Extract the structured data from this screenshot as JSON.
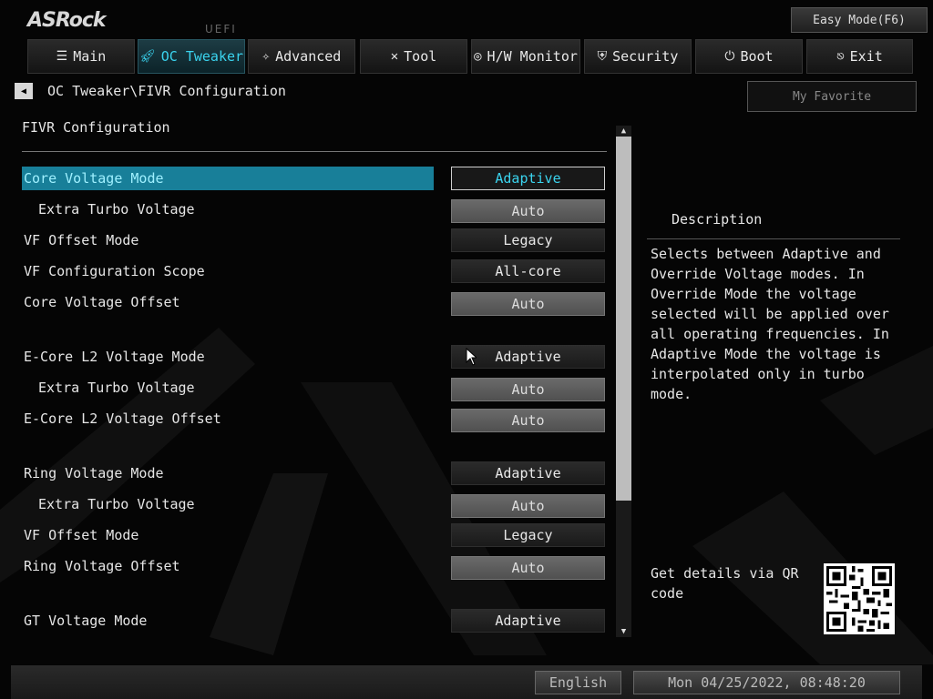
{
  "brand": {
    "logo": "ASRock",
    "firmware": "UEFI"
  },
  "header": {
    "easy_mode": "Easy Mode(F6)"
  },
  "tabs": [
    {
      "label": "Main",
      "icon": "list-icon"
    },
    {
      "label": "OC Tweaker",
      "icon": "rocket-icon",
      "active": true
    },
    {
      "label": "Advanced",
      "icon": "star-icon"
    },
    {
      "label": "Tool",
      "icon": "tools-icon"
    },
    {
      "label": "H/W Monitor",
      "icon": "monitor-icon"
    },
    {
      "label": "Security",
      "icon": "shield-icon"
    },
    {
      "label": "Boot",
      "icon": "power-icon"
    },
    {
      "label": "Exit",
      "icon": "exit-icon"
    }
  ],
  "breadcrumb": "OC Tweaker\\FIVR Configuration",
  "favorite": "My Favorite",
  "section_title": "FIVR Configuration",
  "settings": [
    {
      "label": "Core Voltage Mode",
      "value": "Adaptive"
    },
    {
      "label": "Extra Turbo Voltage",
      "value": "Auto"
    },
    {
      "label": "VF Offset Mode",
      "value": "Legacy"
    },
    {
      "label": "VF Configuration Scope",
      "value": "All-core"
    },
    {
      "label": "Core Voltage Offset",
      "value": "Auto"
    },
    {
      "label": "E-Core L2 Voltage Mode",
      "value": "Adaptive"
    },
    {
      "label": "Extra Turbo Voltage",
      "value": "Auto"
    },
    {
      "label": "E-Core L2 Voltage Offset",
      "value": "Auto"
    },
    {
      "label": "Ring Voltage Mode",
      "value": "Adaptive"
    },
    {
      "label": "Extra Turbo Voltage",
      "value": "Auto"
    },
    {
      "label": "VF Offset Mode",
      "value": "Legacy"
    },
    {
      "label": "Ring Voltage Offset",
      "value": "Auto"
    },
    {
      "label": "GT Voltage Mode",
      "value": "Adaptive"
    }
  ],
  "description": {
    "title": "Description",
    "text": "Selects between Adaptive and Override Voltage modes. In Override Mode the voltage selected will be applied over all operating frequencies. In Adaptive Mode the voltage is interpolated only in turbo mode.",
    "qr_label": "Get details via QR code"
  },
  "footer": {
    "language": "English",
    "datetime": "Mon 04/25/2022, 08:48:20"
  },
  "colors": {
    "accent": "#3ad3ee",
    "selected_bg": "#187f99"
  }
}
